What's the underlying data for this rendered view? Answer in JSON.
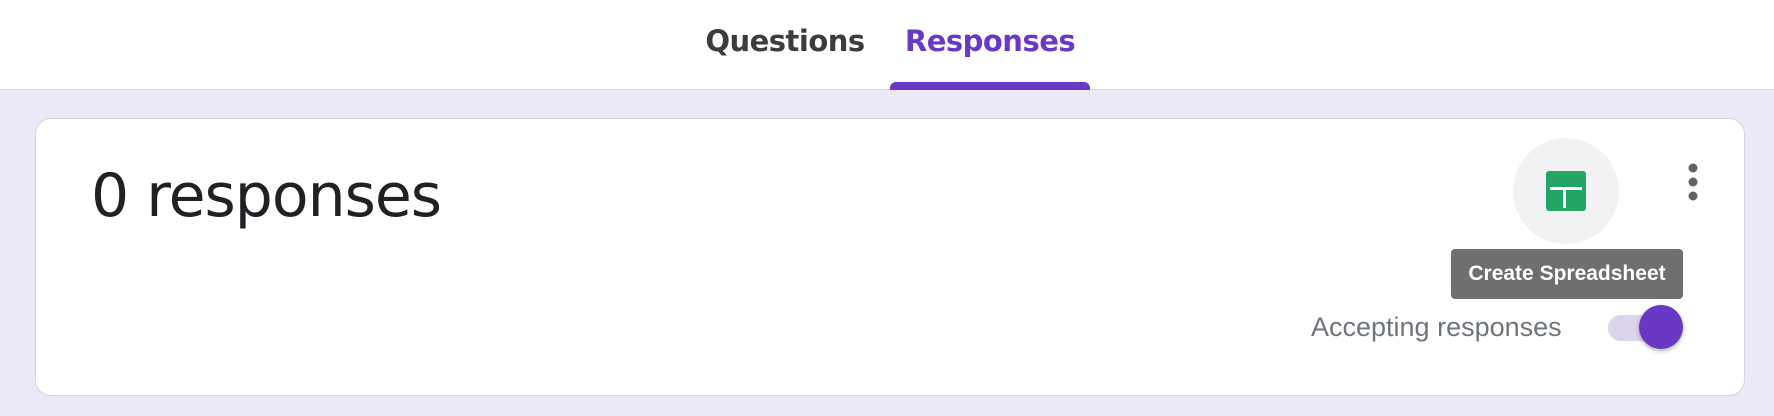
{
  "tabs": [
    {
      "label": "Questions",
      "active": false
    },
    {
      "label": "Responses",
      "active": true
    }
  ],
  "responses": {
    "count_label": "0 responses",
    "sheet_icon": "google-sheets-icon",
    "more_icon": "more-vert-icon",
    "tooltip": "Create Spreadsheet",
    "accepting_label": "Accepting responses",
    "accepting_on": true
  },
  "colors": {
    "accent": "#6938c4",
    "background": "#ede8f6",
    "sheets_green": "#23a566",
    "tooltip_bg": "#6f6f70"
  }
}
